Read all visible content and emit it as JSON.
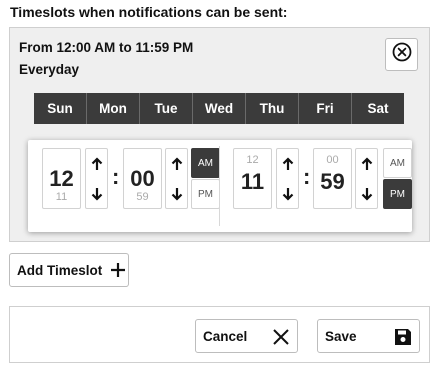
{
  "header": {
    "title": "Timeslots when notifications can be sent:"
  },
  "timeslot": {
    "range": "From 12:00 AM to 11:59 PM",
    "days_label": "Everyday",
    "days": [
      "Sun",
      "Mon",
      "Tue",
      "Wed",
      "Thu",
      "Fri",
      "Sat"
    ],
    "start": {
      "hour": "12",
      "hour_next": "11",
      "minute": "00",
      "minute_next": "59",
      "am": "AM",
      "pm": "PM",
      "period": "AM"
    },
    "end": {
      "hour": "11",
      "hour_prev": "12",
      "minute": "59",
      "minute_prev": "00",
      "am": "AM",
      "pm": "PM",
      "period": "PM"
    }
  },
  "actions": {
    "add_timeslot": "Add Timeslot",
    "cancel": "Cancel",
    "save": "Save"
  },
  "icons": {
    "remove": "close-circle-icon",
    "up": "arrow-up-icon",
    "down": "arrow-down-icon",
    "add": "plus-icon",
    "cancel": "close-icon",
    "save": "floppy-disk-icon"
  },
  "colors": {
    "day_bg": "#3b3b3b",
    "card_bg": "#efefef",
    "active_period": "#3b3b3b"
  }
}
